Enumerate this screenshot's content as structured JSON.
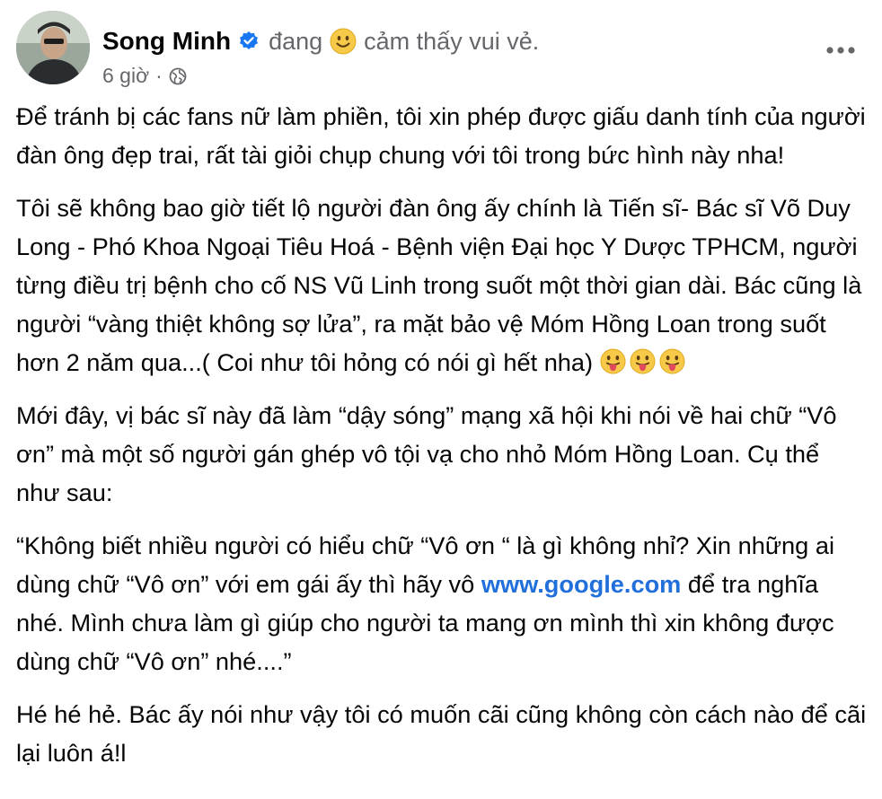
{
  "post": {
    "author": "Song Minh",
    "feeling_prefix": "đang",
    "feeling_text": "cảm thấy vui vẻ.",
    "time": "6 giờ",
    "dot": "·",
    "paragraph1": "Để tránh bị các fans nữ làm phiền, tôi xin phép được giấu danh tính của người đàn ông đẹp trai, rất tài giỏi chụp chung với tôi trong bức hình này nha!",
    "paragraph2": "Tôi sẽ không bao giờ tiết lộ người đàn ông ấy chính là Tiến sĩ- Bác sĩ Võ Duy Long - Phó Khoa Ngoại Tiêu Hoá  - Bệnh viện Đại học Y Dược TPHCM, người từng điều trị bệnh cho cố NS Vũ Linh trong suốt một thời gian dài. Bác cũng là người “vàng thiệt không sợ lửa”, ra mặt bảo vệ Móm Hồng Loan trong suốt hơn 2 năm qua...( Coi như tôi hỏng có nói gì hết nha)",
    "paragraph3": "Mới đây, vị bác sĩ này đã làm “dậy sóng” mạng xã hội khi nói về hai chữ “Vô ơn” mà một số người gán ghép vô tội vạ cho nhỏ  Móm Hồng Loan. Cụ thể như sau:",
    "paragraph4_before_link": "“Không biết nhiều người có hiểu chữ “Vô ơn “ là gì không nhỉ? Xin những ai dùng chữ “Vô ơn” với em gái ấy thì hãy vô ",
    "link": "www.google.com",
    "paragraph4_after_link": " để tra nghĩa nhé. Mình chưa làm gì giúp cho người ta mang ơn mình thì xin không được dùng chữ “Vô ơn” nhé....”",
    "paragraph5": "Hé hé hẻ. Bác ấy nói như vậy tôi có muốn cãi cũng không còn cách nào để cãi lại luôn á!l"
  },
  "icons": {
    "verified": "verified-badge-icon",
    "feeling": "smiling-face-emoji",
    "privacy": "globe-icon",
    "more": "more-options-icon",
    "tongue": "face-with-tongue-emoji"
  },
  "colors": {
    "text": "#050505",
    "secondary": "#65676b",
    "link": "#216fdb",
    "verified": "#1877f2"
  }
}
